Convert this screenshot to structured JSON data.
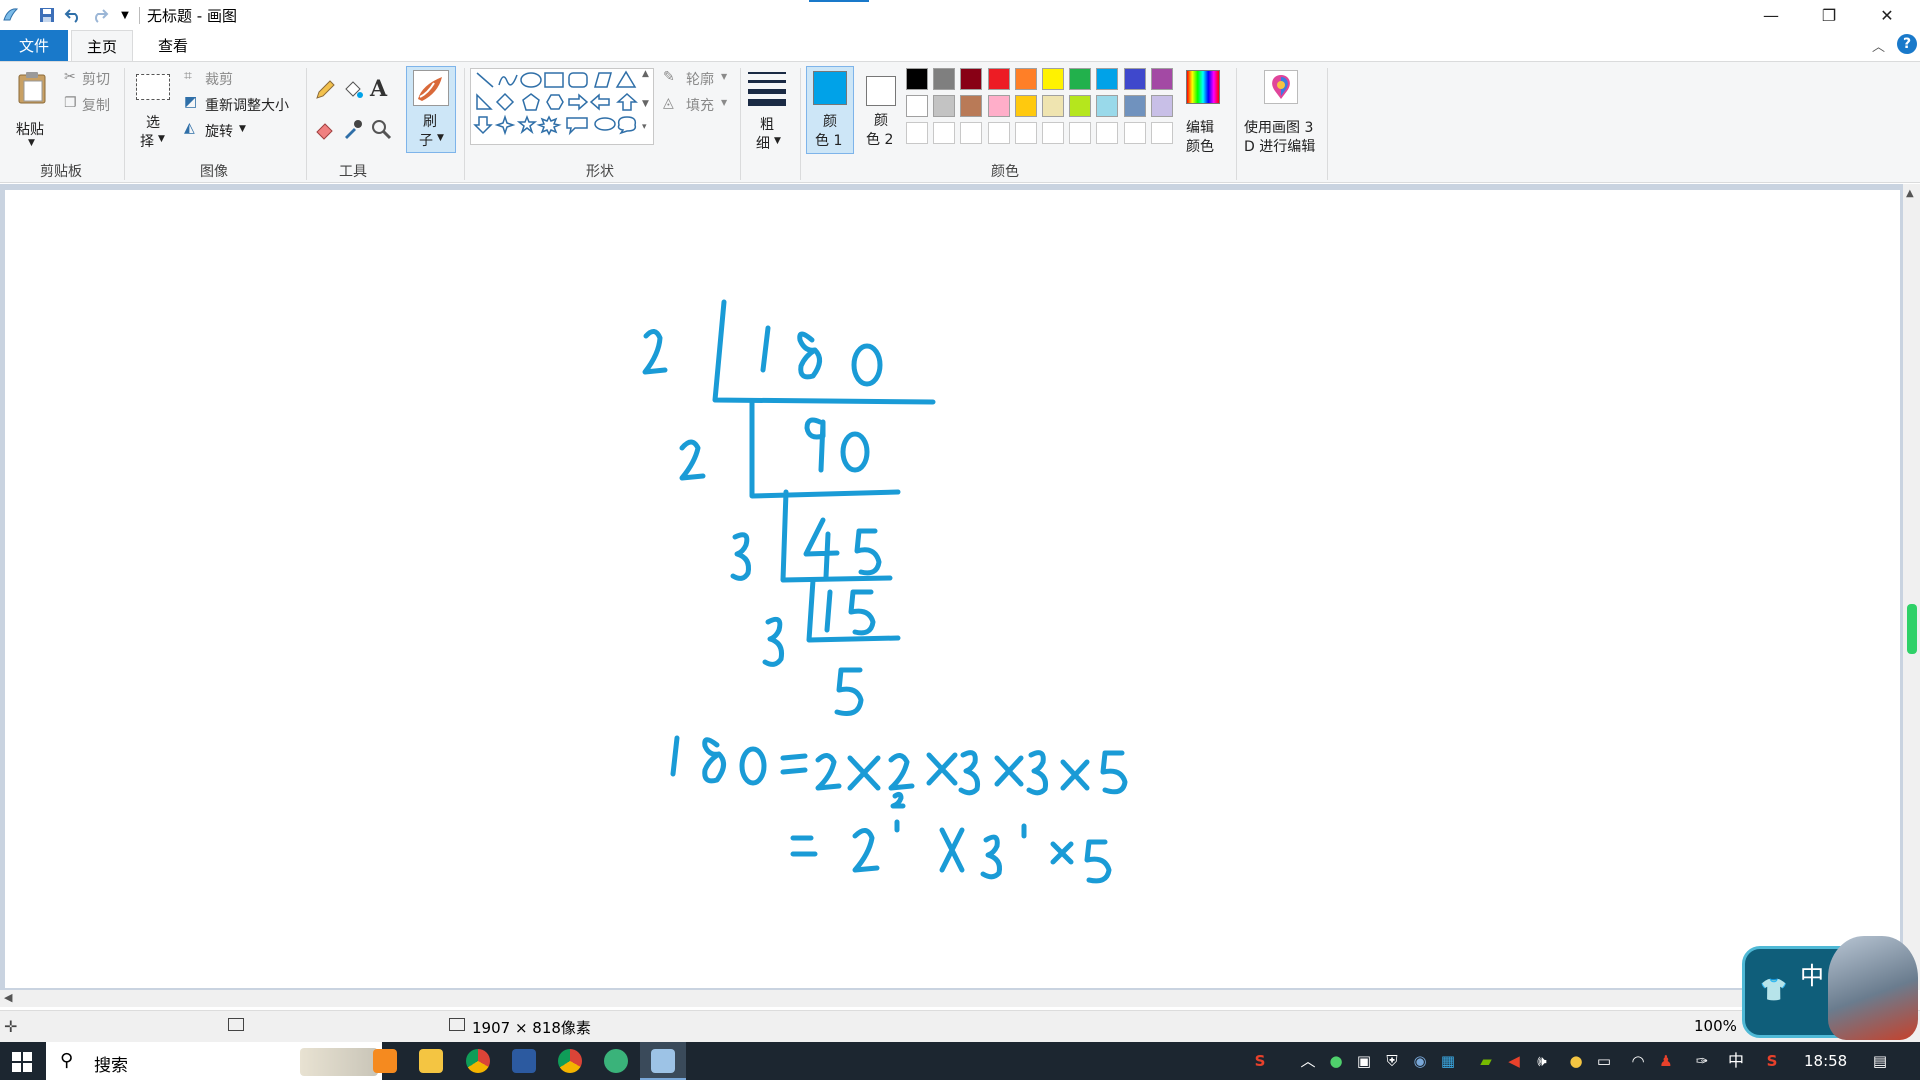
{
  "window": {
    "title": "无标题 - 画图",
    "minimize_glyph": "—",
    "restore_glyph": "❐",
    "close_glyph": "✕"
  },
  "tabs": [
    "文件",
    "主页",
    "查看"
  ],
  "ribbon": {
    "clipboard": {
      "paste": "粘贴",
      "cut": "剪切",
      "copy": "复制",
      "label": "剪贴板"
    },
    "image": {
      "select_line1": "选",
      "select_line2": "择",
      "crop": "裁剪",
      "resize": "重新调整大小",
      "rotate": "旋转",
      "label": "图像"
    },
    "tools": {
      "label": "工具"
    },
    "brushes": {
      "line1": "刷",
      "line2": "子"
    },
    "shapes": {
      "outline": "轮廓",
      "fill": "填充",
      "label": "形状"
    },
    "size": {
      "line1": "粗",
      "line2": "细"
    },
    "color1": {
      "line1": "颜",
      "line2": "色 1"
    },
    "color2": {
      "line1": "颜",
      "line2": "色 2"
    },
    "colors": {
      "label": "颜色",
      "row1": [
        "#000000",
        "#7f7f7f",
        "#880015",
        "#ed1c24",
        "#ff7f27",
        "#fff200",
        "#22b14c",
        "#00a2e8",
        "#3f48cc",
        "#a349a4"
      ],
      "row2": [
        "#ffffff",
        "#c3c3c3",
        "#b97a57",
        "#ffaec9",
        "#ffc90e",
        "#efe4b0",
        "#b5e61d",
        "#99d9ea",
        "#7092be",
        "#c8bfe7"
      ]
    },
    "edit_colors": {
      "line1": "编辑",
      "line2": "颜色"
    },
    "paint3d": {
      "line1": "使用画图 3",
      "line2": "D 进行编辑"
    }
  },
  "accent": {
    "selected_color": "#00a2e8",
    "file_tab": "#1979ca"
  },
  "canvas": {
    "ink_color": "#1a9bd6"
  },
  "statusbar": {
    "canvas_size": "1907 × 818像素",
    "zoom": "100%"
  },
  "taskbar": {
    "search": "搜索",
    "ime": "中",
    "time": "18:58"
  },
  "overlay": {
    "ime_badge": "中"
  }
}
